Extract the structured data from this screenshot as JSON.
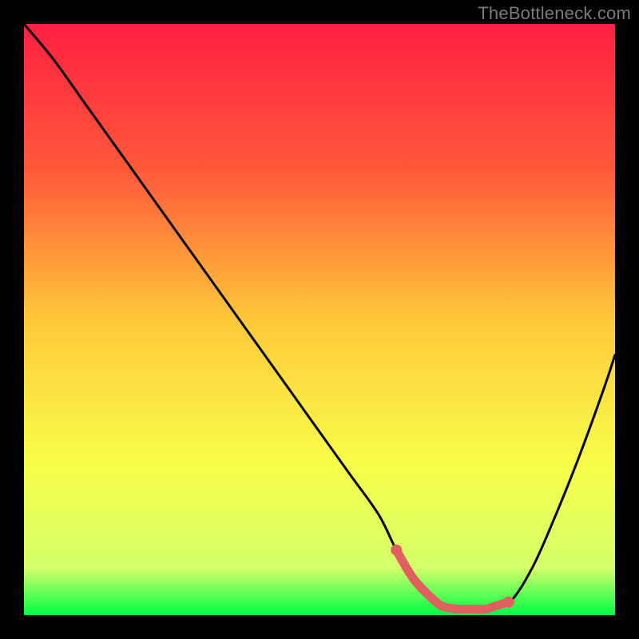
{
  "watermark": "TheBottleneck.com",
  "chart_data": {
    "type": "line",
    "title": "",
    "xlabel": "",
    "ylabel": "",
    "xlim": [
      0,
      100
    ],
    "ylim": [
      0,
      100
    ],
    "gradient_stops": [
      {
        "offset": 0,
        "color": "#ff1f42"
      },
      {
        "offset": 25,
        "color": "#ff5a3a"
      },
      {
        "offset": 50,
        "color": "#ffc83a"
      },
      {
        "offset": 75,
        "color": "#f7ff4a"
      },
      {
        "offset": 92,
        "color": "#d4ff6a"
      },
      {
        "offset": 100,
        "color": "#00ff47"
      }
    ],
    "series": [
      {
        "name": "bottleneck-curve",
        "color": "#000000",
        "x": [
          0,
          5,
          10,
          15,
          20,
          25,
          30,
          35,
          40,
          45,
          50,
          55,
          60,
          63,
          66,
          70,
          72,
          75,
          78,
          82,
          86,
          90,
          94,
          98,
          100
        ],
        "y": [
          100,
          94,
          87,
          80,
          73,
          66,
          59,
          52,
          45,
          38,
          31,
          24,
          17,
          11,
          6,
          2,
          1,
          1,
          1,
          2,
          8,
          17,
          27,
          38,
          44
        ]
      }
    ],
    "highlight": {
      "name": "optimal-range",
      "color": "#e06060",
      "x": [
        63,
        66,
        70,
        72,
        74,
        76,
        78,
        80,
        82
      ],
      "y": [
        11,
        6,
        2,
        1.2,
        1.0,
        1.0,
        1.0,
        1.6,
        2.2
      ],
      "endpoints": [
        {
          "x": 63,
          "y": 11
        },
        {
          "x": 82,
          "y": 2.2
        }
      ]
    }
  }
}
